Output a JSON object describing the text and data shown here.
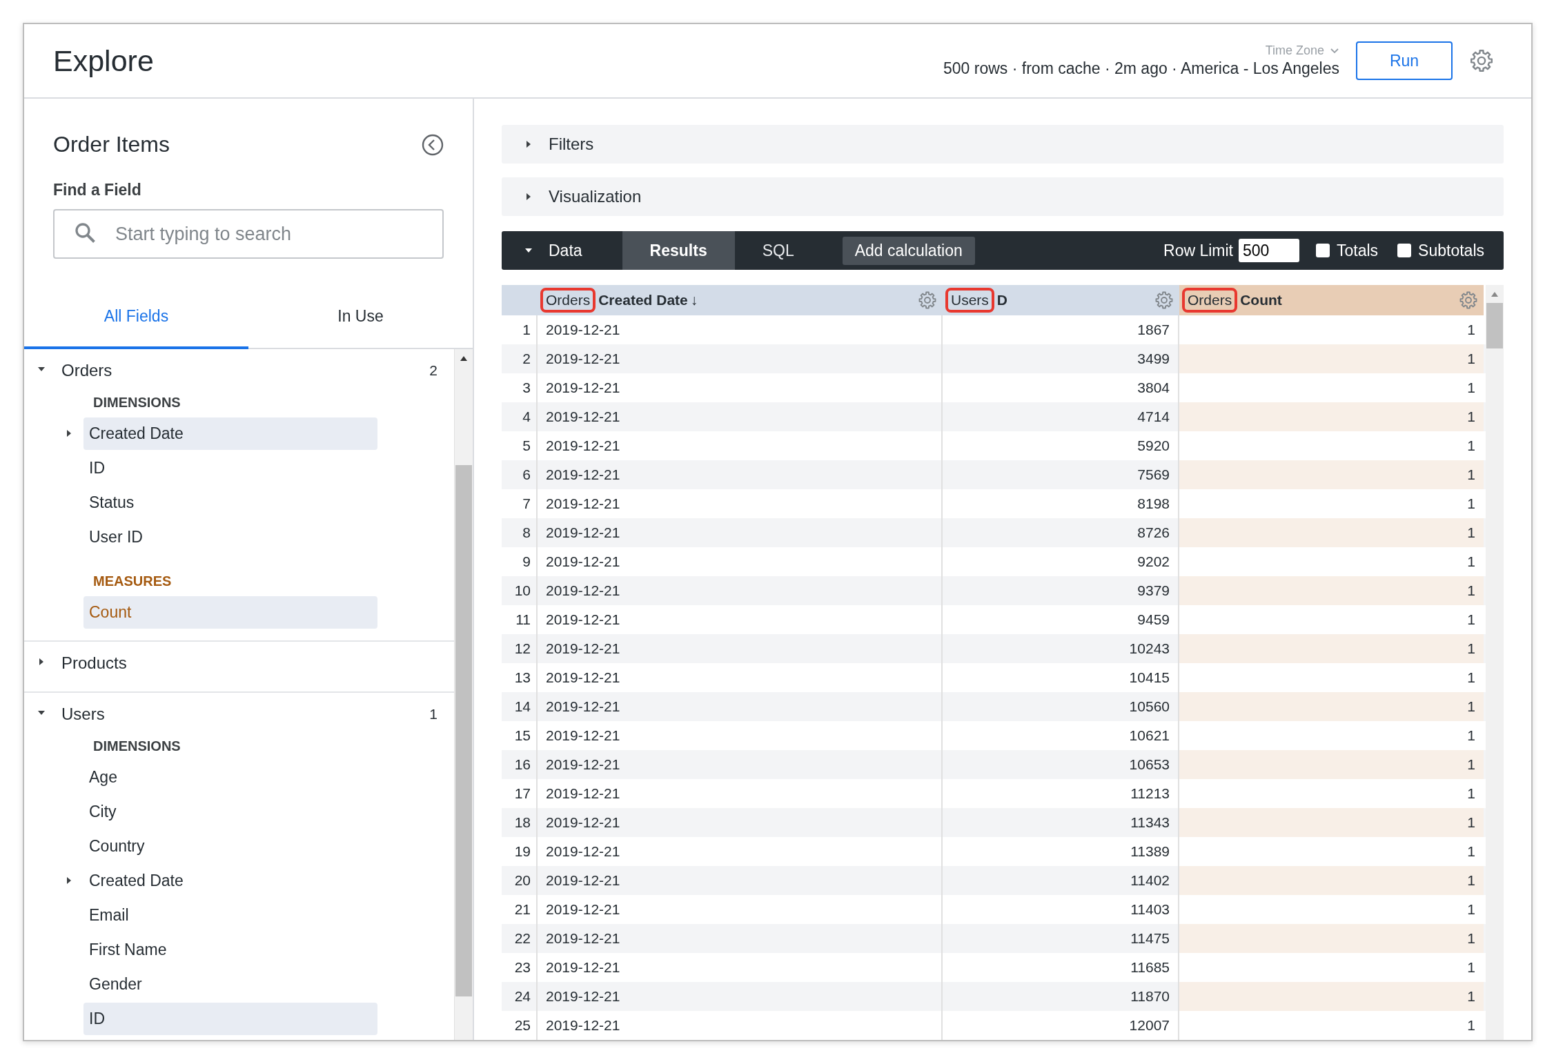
{
  "header": {
    "title": "Explore",
    "time_zone_label": "Time Zone",
    "status": "500 rows · from cache · 2m ago · America - Los Angeles",
    "run_button": "Run"
  },
  "sidebar": {
    "title": "Order Items",
    "find_label": "Find a Field",
    "search": {
      "placeholder": "Start typing to search"
    },
    "tabs": [
      {
        "label": "All Fields",
        "selected": true
      },
      {
        "label": "In Use",
        "selected": false
      }
    ],
    "views": [
      {
        "name": "Orders",
        "count": "2",
        "expanded": true,
        "sections": [
          {
            "kind": "dimensions",
            "heading": "DIMENSIONS",
            "fields": [
              {
                "label": "Created Date",
                "kind": "group",
                "expanded": false,
                "in_use": true
              },
              {
                "label": "ID",
                "kind": "field",
                "in_use": false
              },
              {
                "label": "Status",
                "kind": "field",
                "in_use": false
              },
              {
                "label": "User ID",
                "kind": "field",
                "in_use": false
              }
            ]
          },
          {
            "kind": "measures",
            "heading": "MEASURES",
            "fields": [
              {
                "label": "Count",
                "kind": "field",
                "in_use": true
              }
            ]
          }
        ]
      },
      {
        "name": "Products",
        "expanded": false
      },
      {
        "name": "Users",
        "count": "1",
        "expanded": true,
        "sections": [
          {
            "kind": "dimensions",
            "heading": "DIMENSIONS",
            "fields": [
              {
                "label": "Age",
                "kind": "field",
                "in_use": false
              },
              {
                "label": "City",
                "kind": "field",
                "in_use": false
              },
              {
                "label": "Country",
                "kind": "field",
                "in_use": false
              },
              {
                "label": "Created Date",
                "kind": "group",
                "expanded": false,
                "in_use": false
              },
              {
                "label": "Email",
                "kind": "field",
                "in_use": false
              },
              {
                "label": "First Name",
                "kind": "field",
                "in_use": false
              },
              {
                "label": "Gender",
                "kind": "field",
                "in_use": false
              },
              {
                "label": "ID",
                "kind": "field",
                "in_use": true
              }
            ]
          }
        ]
      }
    ]
  },
  "panels": [
    {
      "label": "Filters",
      "expanded": false
    },
    {
      "label": "Visualization",
      "expanded": false
    }
  ],
  "data_bar": {
    "label": "Data",
    "expanded": true,
    "tabs": [
      {
        "label": "Results",
        "selected": true
      },
      {
        "label": "SQL",
        "selected": false
      }
    ],
    "add_calculation": "Add calculation",
    "row_limit_label": "Row Limit",
    "row_limit": "500",
    "options": [
      {
        "label": "Totals",
        "checked": false
      },
      {
        "label": "Subtotals",
        "checked": false
      }
    ]
  },
  "table": {
    "columns": [
      {
        "view": "Orders",
        "field": "Created Date",
        "sort": "↓",
        "kind": "dimension",
        "numeric": false,
        "highlighted": true
      },
      {
        "view": "Users",
        "field": "D",
        "kind": "dimension",
        "numeric": true,
        "highlighted": true
      },
      {
        "view": "Orders",
        "field": "Count",
        "kind": "measure",
        "numeric": true,
        "highlighted": true
      }
    ],
    "rows": [
      {
        "number": "1",
        "cells": [
          "2019-12-21",
          "1867",
          "1"
        ]
      },
      {
        "number": "2",
        "cells": [
          "2019-12-21",
          "3499",
          "1"
        ]
      },
      {
        "number": "3",
        "cells": [
          "2019-12-21",
          "3804",
          "1"
        ]
      },
      {
        "number": "4",
        "cells": [
          "2019-12-21",
          "4714",
          "1"
        ]
      },
      {
        "number": "5",
        "cells": [
          "2019-12-21",
          "5920",
          "1"
        ]
      },
      {
        "number": "6",
        "cells": [
          "2019-12-21",
          "7569",
          "1"
        ]
      },
      {
        "number": "7",
        "cells": [
          "2019-12-21",
          "8198",
          "1"
        ]
      },
      {
        "number": "8",
        "cells": [
          "2019-12-21",
          "8726",
          "1"
        ]
      },
      {
        "number": "9",
        "cells": [
          "2019-12-21",
          "9202",
          "1"
        ]
      },
      {
        "number": "10",
        "cells": [
          "2019-12-21",
          "9379",
          "1"
        ]
      },
      {
        "number": "11",
        "cells": [
          "2019-12-21",
          "9459",
          "1"
        ]
      },
      {
        "number": "12",
        "cells": [
          "2019-12-21",
          "10243",
          "1"
        ]
      },
      {
        "number": "13",
        "cells": [
          "2019-12-21",
          "10415",
          "1"
        ]
      },
      {
        "number": "14",
        "cells": [
          "2019-12-21",
          "10560",
          "1"
        ]
      },
      {
        "number": "15",
        "cells": [
          "2019-12-21",
          "10621",
          "1"
        ]
      },
      {
        "number": "16",
        "cells": [
          "2019-12-21",
          "10653",
          "1"
        ]
      },
      {
        "number": "17",
        "cells": [
          "2019-12-21",
          "11213",
          "1"
        ]
      },
      {
        "number": "18",
        "cells": [
          "2019-12-21",
          "11343",
          "1"
        ]
      },
      {
        "number": "19",
        "cells": [
          "2019-12-21",
          "11389",
          "1"
        ]
      },
      {
        "number": "20",
        "cells": [
          "2019-12-21",
          "11402",
          "1"
        ]
      },
      {
        "number": "21",
        "cells": [
          "2019-12-21",
          "11403",
          "1"
        ]
      },
      {
        "number": "22",
        "cells": [
          "2019-12-21",
          "11475",
          "1"
        ]
      },
      {
        "number": "23",
        "cells": [
          "2019-12-21",
          "11685",
          "1"
        ]
      },
      {
        "number": "24",
        "cells": [
          "2019-12-21",
          "11870",
          "1"
        ]
      },
      {
        "number": "25",
        "cells": [
          "2019-12-21",
          "12007",
          "1"
        ]
      }
    ]
  }
}
